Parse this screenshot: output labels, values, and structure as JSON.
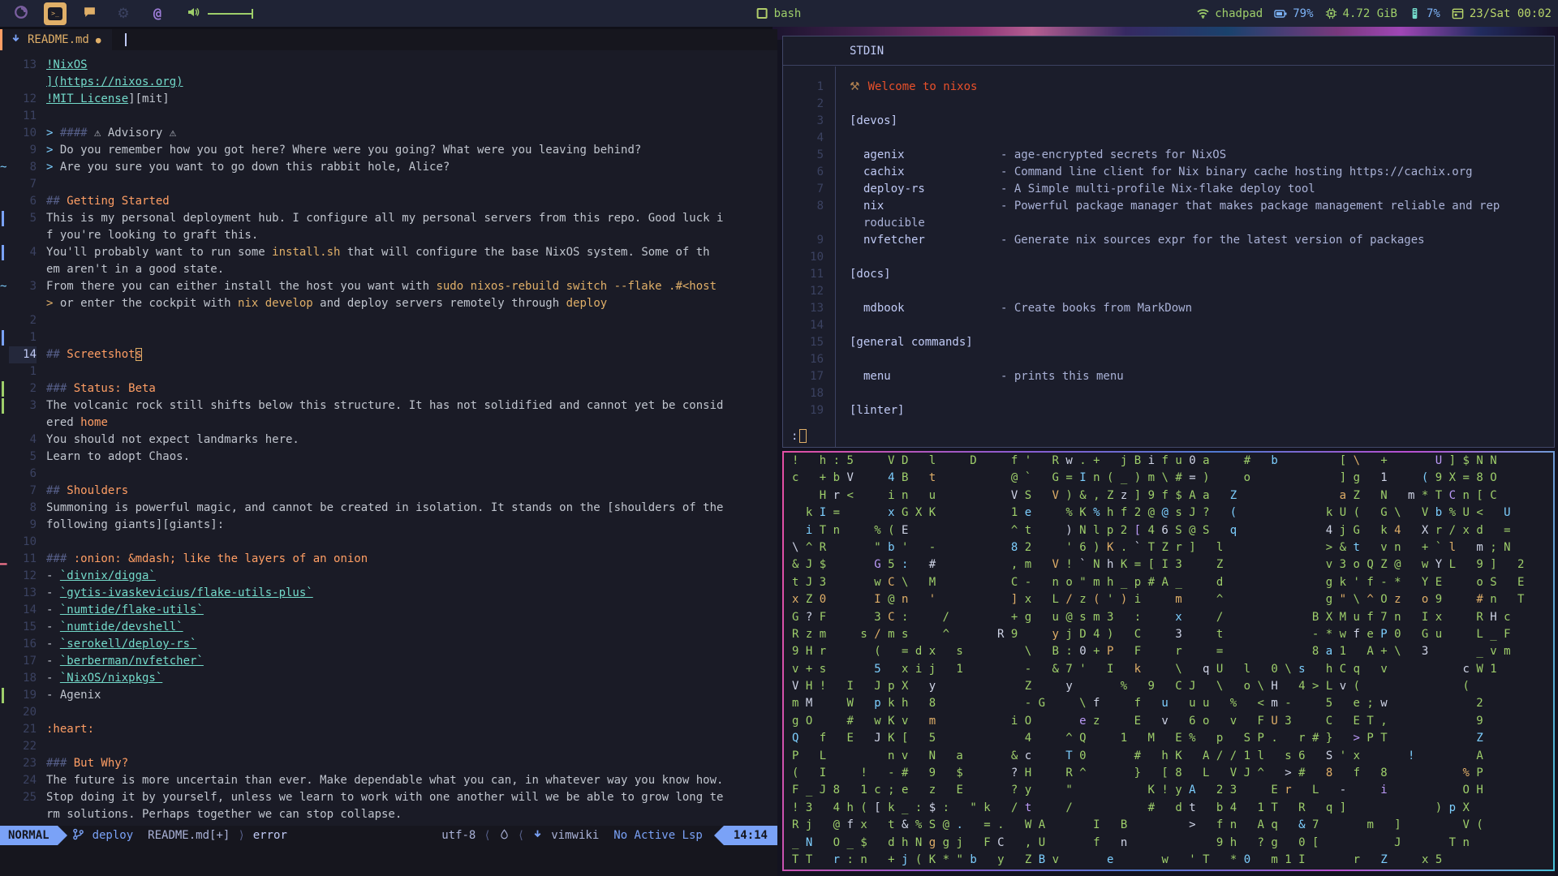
{
  "colors": {
    "fg": "#c0c5ce",
    "bright": "#c0caf5",
    "orange": "#ff9e64",
    "code": "#e0af68",
    "link": "#73daca",
    "punct": "#565f89",
    "quote": "#7dcfff",
    "green": "#9ece6a",
    "blue": "#7aa2f7",
    "red": "#f7768e",
    "accent": "#e0af68",
    "matrix_green": "#9ece6a",
    "matrix_white": "#cfd4e6",
    "matrix_cyan": "#7dcfff",
    "matrix_yellow": "#e0af68",
    "matrix_purple": "#bb9af7"
  },
  "topbar": {
    "workspaces": [
      {
        "icon": "firefox-icon",
        "active": false
      },
      {
        "icon": "terminal-icon",
        "active": true
      },
      {
        "icon": "chat-icon",
        "active": false
      },
      {
        "icon": "gear-icon",
        "active": false
      },
      {
        "icon": "at-icon",
        "active": false
      }
    ],
    "window_title": "bash",
    "status": [
      {
        "icon": "wifi-icon",
        "text": "chadpad",
        "color": "c-green"
      },
      {
        "icon": "battery-icon",
        "text": "79%",
        "color": "c-blue"
      },
      {
        "icon": "cpu-icon",
        "text": "4.72 GiB",
        "color": "c-green"
      },
      {
        "icon": "ram-icon",
        "text": "7%",
        "color": "c-blue"
      },
      {
        "icon": "calendar-icon",
        "text": "23/Sat 00:02",
        "color": "c-lime"
      }
    ]
  },
  "editor": {
    "tab": {
      "filename": "README.md",
      "modified_dot": "●"
    },
    "lines": [
      {
        "n": "13",
        "segs": [
          [
            "!NixOS",
            "link"
          ]
        ]
      },
      {
        "segs": [
          [
            "](https://nixos.org)",
            "link"
          ]
        ]
      },
      {
        "n": "12",
        "segs": [
          [
            "!MIT License",
            "link"
          ],
          [
            "][mit]",
            "fg"
          ]
        ]
      },
      {
        "n": "11",
        "segs": []
      },
      {
        "n": "10",
        "segs": [
          [
            "> ",
            "quote"
          ],
          [
            "#### ",
            "punct"
          ],
          [
            "⚠ Advisory ⚠",
            "fg"
          ]
        ]
      },
      {
        "n": "9",
        "segs": [
          [
            "> ",
            "quote"
          ],
          [
            "Do you remember how you got here? Where were you going? What were you leaving behind?",
            "fg"
          ]
        ]
      },
      {
        "n": "8",
        "s": "tilde",
        "segs": [
          [
            "> ",
            "quote"
          ],
          [
            "Are you sure you want to go down this rabbit hole, Alice?",
            "fg"
          ]
        ]
      },
      {
        "n": "7",
        "segs": []
      },
      {
        "n": "6",
        "segs": [
          [
            "## ",
            "punct"
          ],
          [
            "Getting Started",
            "orange"
          ]
        ]
      },
      {
        "n": "5",
        "s": "change",
        "segs": [
          [
            "This is my personal deployment hub. I configure all my personal servers from this repo. Good luck i",
            "fg"
          ]
        ]
      },
      {
        "segs": [
          [
            "f you're looking to graft this.",
            "fg"
          ]
        ]
      },
      {
        "n": "4",
        "s": "change",
        "segs": [
          [
            "You'll probably want to run some ",
            "fg"
          ],
          [
            "install.sh",
            "code"
          ],
          [
            " that will configure the base NixOS system. Some of th",
            "fg"
          ]
        ]
      },
      {
        "segs": [
          [
            "em aren't in a good state.",
            "fg"
          ]
        ]
      },
      {
        "n": "3",
        "s": "tilde",
        "segs": [
          [
            "From there you can either install the host you want with ",
            "fg"
          ],
          [
            "sudo nixos-rebuild switch --flake .#<host",
            "code"
          ]
        ]
      },
      {
        "segs": [
          [
            ">",
            "code"
          ],
          [
            " or enter the cockpit with ",
            "fg"
          ],
          [
            "nix develop",
            "code"
          ],
          [
            " and deploy servers remotely through ",
            "fg"
          ],
          [
            "deploy",
            "code"
          ]
        ]
      },
      {
        "n": "2",
        "segs": []
      },
      {
        "n": "1",
        "s": "change",
        "segs": []
      },
      {
        "n": "14",
        "cur": true,
        "segs": [
          [
            "## ",
            "punct"
          ],
          [
            "Screetshot",
            "orange"
          ],
          [
            "s",
            "cursor"
          ]
        ]
      },
      {
        "n": "1",
        "segs": []
      },
      {
        "n": "2",
        "s": "add",
        "segs": [
          [
            "### ",
            "punct"
          ],
          [
            "Status: Beta",
            "orange"
          ]
        ]
      },
      {
        "n": "3",
        "s": "add",
        "segs": [
          [
            "The volcanic rock still shifts below this structure. It has not solidified and cannot yet be consid",
            "fg"
          ]
        ]
      },
      {
        "segs": [
          [
            "ered ",
            "fg"
          ],
          [
            "home",
            "orange"
          ]
        ]
      },
      {
        "n": "4",
        "segs": [
          [
            "You should not expect landmarks here.",
            "fg"
          ]
        ]
      },
      {
        "n": "5",
        "segs": [
          [
            "Learn to adopt Chaos.",
            "fg"
          ]
        ]
      },
      {
        "n": "6",
        "segs": []
      },
      {
        "n": "7",
        "segs": [
          [
            "## ",
            "punct"
          ],
          [
            "Shoulders",
            "orange"
          ]
        ]
      },
      {
        "n": "8",
        "segs": [
          [
            "Summoning is powerful magic, and cannot be created in isolation. It stands on the [shoulders of the",
            "fg"
          ]
        ]
      },
      {
        "n": "9",
        "segs": [
          [
            "following giants][giants]:",
            "fg"
          ]
        ]
      },
      {
        "n": "10",
        "segs": []
      },
      {
        "n": "11",
        "s": "delete",
        "segs": [
          [
            "### ",
            "punct"
          ],
          [
            ":onion: &mdash; like the layers of an onion",
            "orange"
          ]
        ]
      },
      {
        "n": "12",
        "segs": [
          [
            "- ",
            "fg"
          ],
          [
            "`divnix/digga`",
            "link"
          ]
        ]
      },
      {
        "n": "13",
        "segs": [
          [
            "- ",
            "fg"
          ],
          [
            "`gytis-ivaskevicius/flake-utils-plus`",
            "link"
          ]
        ]
      },
      {
        "n": "14",
        "segs": [
          [
            "- ",
            "fg"
          ],
          [
            "`numtide/flake-utils`",
            "link"
          ]
        ]
      },
      {
        "n": "15",
        "segs": [
          [
            "- ",
            "fg"
          ],
          [
            "`numtide/devshell`",
            "link"
          ]
        ]
      },
      {
        "n": "16",
        "segs": [
          [
            "- ",
            "fg"
          ],
          [
            "`serokell/deploy-rs`",
            "link"
          ]
        ]
      },
      {
        "n": "17",
        "segs": [
          [
            "- ",
            "fg"
          ],
          [
            "`berberman/nvfetcher`",
            "link"
          ]
        ]
      },
      {
        "n": "18",
        "segs": [
          [
            "- ",
            "fg"
          ],
          [
            "`NixOS/nixpkgs`",
            "link"
          ]
        ]
      },
      {
        "n": "19",
        "s": "add",
        "segs": [
          [
            "- Agenix",
            "fg"
          ]
        ]
      },
      {
        "n": "20",
        "segs": []
      },
      {
        "n": "21",
        "segs": [
          [
            ":heart:",
            "orange"
          ]
        ]
      },
      {
        "n": "22",
        "segs": []
      },
      {
        "n": "23",
        "segs": [
          [
            "### ",
            "punct"
          ],
          [
            "But Why?",
            "orange"
          ]
        ]
      },
      {
        "n": "24",
        "segs": [
          [
            "The future is more uncertain than ever. Make dependable what you can, in whatever way you know how.",
            "fg"
          ]
        ]
      },
      {
        "n": "25",
        "segs": [
          [
            "Stop doing it by yourself, unless we learn to work with one another will we be able to grow long te",
            "fg"
          ]
        ]
      },
      {
        "segs": [
          [
            "rm solutions. Perhaps together we can stop collapse.",
            "fg"
          ]
        ]
      }
    ],
    "statusline": {
      "mode": "NORMAL",
      "branch": "deploy",
      "file": "README.md[+]",
      "sep_right": "⟩",
      "diagnostic": "error",
      "encoding": "utf-8",
      "sep_left": "⟨",
      "filetype": "vimwiki",
      "lsp": "No Active Lsp",
      "time": "14:14"
    }
  },
  "pager": {
    "header": "STDIN",
    "prompt": ":",
    "title_icon": "⚒",
    "lines": [
      {
        "n": "1",
        "kind": "title",
        "text": "Welcome to nixos"
      },
      {
        "n": "2"
      },
      {
        "n": "3",
        "kind": "section",
        "text": "[devos]"
      },
      {
        "n": "4"
      },
      {
        "n": "5",
        "name": "agenix",
        "desc": "- age-encrypted secrets for NixOS"
      },
      {
        "n": "6",
        "name": "cachix",
        "desc": "- Command line client for Nix binary cache hosting https://cachix.org"
      },
      {
        "n": "7",
        "name": "deploy-rs",
        "desc": "- A Simple multi-profile Nix-flake deploy tool"
      },
      {
        "n": "8",
        "name": "nix",
        "desc": "- Powerful package manager that makes package management reliable and rep"
      },
      {
        "n": "",
        "kind": "wrap",
        "text": "roducible"
      },
      {
        "n": "9",
        "name": "nvfetcher",
        "desc": "- Generate nix sources expr for the latest version of packages"
      },
      {
        "n": "10"
      },
      {
        "n": "11",
        "kind": "section",
        "text": "[docs]"
      },
      {
        "n": "12"
      },
      {
        "n": "13",
        "name": "mdbook",
        "desc": "- Create books from MarkDown"
      },
      {
        "n": "14"
      },
      {
        "n": "15",
        "kind": "section",
        "text": "[general commands]"
      },
      {
        "n": "16"
      },
      {
        "n": "17",
        "name": "menu",
        "desc": "- prints this menu"
      },
      {
        "n": "18"
      },
      {
        "n": "19",
        "kind": "section",
        "text": "[linter]"
      }
    ]
  },
  "matrix": {
    "rows": [
      "!   h : 5     V D   l     D     f '   R w . +   j B i f u 0 a     #   b         [ \\   +       U ] $ N N",
      "c   + b V     4 B   t           @ `   G = I n ( _ ) m \\ # = )     o             ] g   1     ( 9 X = 8 O",
      "    H r <     i n   u           V S   V ) & , Z z ] 9 f $ A a   Z               a Z   N   m * T C n [ C",
      "  k I =       x G X K           1 e     % K % h f 2 @ @ s J ?   (             k U (   G \\   V b % U <   U",
      "  i T n     % ( E               ^ t     ) N l p 2 [ 4 6 S @ S   q             4 j G   k 4   X r / x d   =",
      "\\ ^ R       \" b '   -           8 2     ' 6 ) K . ` T Z r ]   l               > & t   v n   + ` l   m ; N",
      "& J $       G 5 :   #           , m   V ! ` N h K = [ I 3     Z               v 3 o Q Z @   w Y L   9 ]   2",
      "t J 3       w C \\   M           C -   n o \" m h _ p # A _     d               g k ' f - *   Y E     o S   E",
      "x Z 0       I @ n   '           ] x   L / z ( ' ) i     m     ^               g \" \\ ^ O z   o 9     # n   T",
      "G ? F       3 C :     /         + g   u @ s m 3   :     x     /             B X M u f 7 n   I x     R H c",
      "R z m     s / m s     ^       R 9     y j D 4 )   C     3     t             - * w f e P 0   G u     L _ F",
      "9 H r       (   = d x   s         \\   B : 0 + P   F     r     =             8 a 1   A + \\   3       _ v m",
      "v + s       5   x i j   1         -   & 7 '   I   k     \\   q U   l   0 \\ s   h C q   v           c W 1",
      "V H !   I   J p X   y             Z     y       %   9   C J   \\   o \\ H   4 > L v (               (",
      "m M     W   p k h   8             - G     \\ f     f   u   u u   %   < m -     5   e ; w             2",
      "g O     #   w K v   m           i O       e z     E   v   6 o   v   F U 3     C   E T ,             9",
      "Q   f   E   J K [   5             4     ^ Q     1   M   E %   p   S P .   r # }   > P T             Z",
      "P   L         n v   N   a       & c     T 0       #   h K   A / / 1 l   s 6   S ' x       !         A",
      "(   I     !   - #   9   $       ? H     R ^       }   [ 8   L   V J ^   > #   8   f   8           % P",
      "F _ J 8   1 c ; e   z   E       ? y     \"           K ! y A   2 3     E r   L   -     i           O H",
      "! 3   4 h ( [ k _ : $ :   \" k   / t     /           #   d t   b 4   1 T   R   q ]             ) p X",
      "R j   @ f x   t & % S @ .   = .   W A       I   B         >   f n   A q   & 7       m   ]         V (",
      "_ N   O _ $   d h N g g j   F C   , U       f   n             9 h   ? g   0 [           J       T n",
      "T T   r : n   + j ( K * \" b   y   Z B v       e       w   ' T   * 0   m 1 I       r   Z     x 5"
    ]
  }
}
